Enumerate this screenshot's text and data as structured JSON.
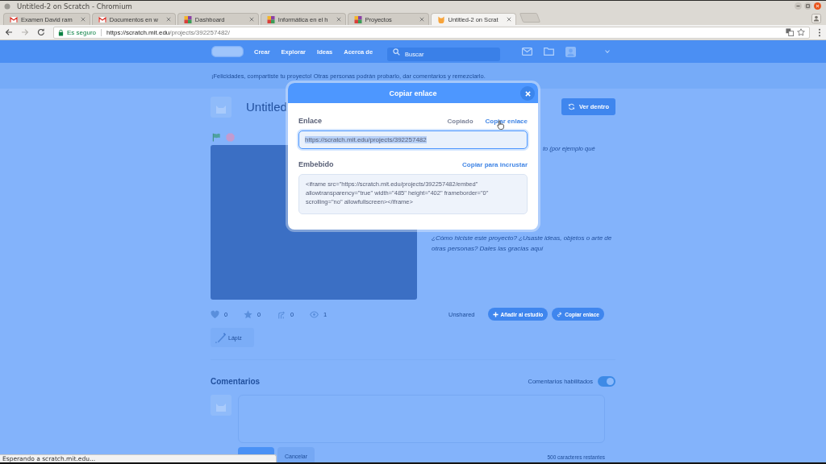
{
  "window": {
    "title": "Untitled-2 on Scratch - Chromium"
  },
  "tabs": [
    {
      "label": "Examen David ram",
      "kind": "mail",
      "selected": false
    },
    {
      "label": "Documentos en w",
      "kind": "mail",
      "selected": false
    },
    {
      "label": "Dashboard",
      "kind": "squares",
      "selected": false
    },
    {
      "label": "Informática en el h",
      "kind": "squares",
      "selected": false
    },
    {
      "label": "Proyectos",
      "kind": "squares",
      "selected": false
    },
    {
      "label": "Untitled-2 on Scrat",
      "kind": "cat",
      "selected": true
    }
  ],
  "address_bar": {
    "security": "Es seguro",
    "url_host": "https://scratch.mit.edu",
    "url_path": "/projects/392257482/"
  },
  "site_nav": {
    "links": [
      "Crear",
      "Explorar",
      "Ideas",
      "Acerca de"
    ],
    "search": {
      "placeholder": "Buscar"
    }
  },
  "banner": "¡Felicidades, compartiste tu proyecto! Otras personas podrán probarlo, dar comentarios y remezclarlo.",
  "project": {
    "title": "Untitled",
    "see_inside": "Ver dentro",
    "instructions": "to (por ejemplo qué",
    "notes": "¿Cómo hiciste este proyecto? ¿Usaste ideas, objetos o arte de otras personas? Dales las gracias aquí",
    "stats": [
      {
        "kind": "love",
        "count": "0"
      },
      {
        "kind": "favorite",
        "count": "0"
      },
      {
        "kind": "remix",
        "count": "0"
      },
      {
        "kind": "views",
        "count": "1"
      }
    ],
    "share_status": "Unshared",
    "actions": [
      {
        "kind": "studio",
        "label": "Añadir al estudio"
      },
      {
        "kind": "link",
        "label": "Copiar enlace"
      }
    ],
    "extension": "Lápiz"
  },
  "comments": {
    "title": "Comentarios",
    "toggle": {
      "label": "Comentarios habilitados",
      "on": true
    },
    "buttons": [
      {
        "kind": "primary"
      },
      {
        "kind": "secondary",
        "label": "Cancelar"
      }
    ],
    "remaining": "500 caracteres restantes"
  },
  "modal": {
    "title": "Copiar enlace",
    "link": {
      "label": "Enlace",
      "status": "Copiado",
      "action": "Copiar enlace",
      "value": "https://scratch.mit.edu/projects/392257482",
      "text_selected": true
    },
    "embed": {
      "label": "Embebido",
      "action": "Copiar para incrustar",
      "value": "<iframe src=\"https://scratch.mit.edu/projects/392257482/embed\" allowtransparency=\"true\" width=\"485\" height=\"402\" frameborder=\"0\" scrolling=\"no\" allowfullscreen></iframe>"
    }
  },
  "status_bar": "Esperando a scratch.mit.edu..."
}
